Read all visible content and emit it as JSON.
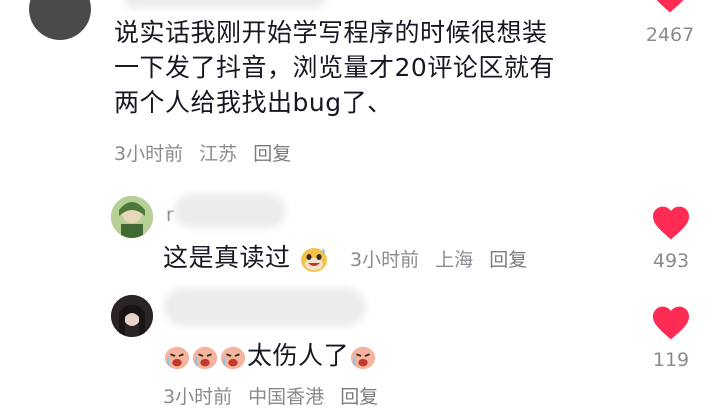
{
  "main_comment": {
    "text_lines": [
      "说实话我刚开始学写程序的时候很想装",
      "一下发了抖音，浏览量才20评论区就有",
      "两个人给我找出bug了、"
    ],
    "time": "3小时前",
    "location": "江苏",
    "reply_label": "回复",
    "like_count": "2467"
  },
  "replies": [
    {
      "name_partial": "r",
      "text": "这是真读过",
      "emoji": "grinning-sweat-emoji",
      "time": "3小时前",
      "location": "上海",
      "reply_label": "回复",
      "like_count": "493"
    },
    {
      "text": "太伤人了",
      "emoji": "crying-emoji",
      "time": "3小时前",
      "location": "中国香港",
      "reply_label": "回复",
      "like_count": "119"
    }
  ],
  "colors": {
    "heart": "#fe2c55",
    "text": "#161823",
    "meta": "#8a8b91"
  }
}
